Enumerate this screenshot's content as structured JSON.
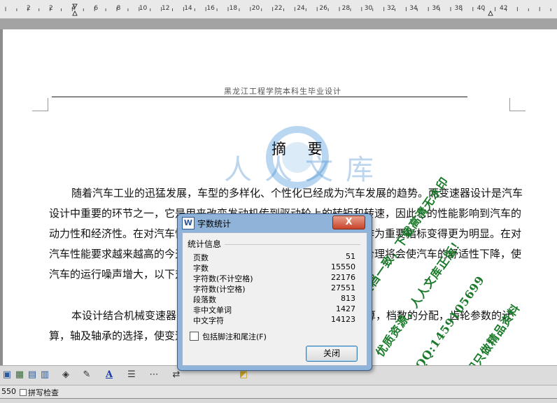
{
  "ruler": {
    "numbers": [
      "2",
      "2",
      "4",
      "6",
      "8",
      "10",
      "12",
      "14",
      "16",
      "18",
      "20",
      "22",
      "24",
      "26",
      "28",
      "30",
      "32",
      "34",
      "36",
      "38",
      "40",
      "42"
    ]
  },
  "document": {
    "header_text": "黑龙江工程学院本科生毕业设计",
    "title": "摘 要",
    "paragraph1": "随着汽车工业的迅猛发展，车型的多样化、个性化已经成为汽车发展的趋势。而变速器设计是汽车设计中重要的环节之一，它是用来改变发动机传到驱动轮上的转矩和转速，因此它的性能影响到汽车的动力性和经济性。在对汽车性能要求越来越高的今天，车辆的舒适性作为重要指标变得更为明显。在对汽车性能要求越来越高的今天，车辆的舒适性而变速器的设计如果不合理将会使汽车的舒适性下降，使汽车的运行噪声增大，以下对乘用车变速器进行系统深入的研究。",
    "paragraph2": "本设计结合机械变速器的设计方法，对变速器进行了系统化的计算，档数的分配，齿轮参数的计算，轴及轴承的选择，使变速器的传动效率有了很大的提高。"
  },
  "watermark": {
    "line1": "人人文库",
    "stamp1": "预览与源文档一致，下载高清无水印",
    "stamp2": "优质资源，人人文库正版！",
    "stamp3": "QQ:1459105699",
    "stamp4": "我们只做精品资料"
  },
  "dialog": {
    "title": "字数统计",
    "close_glyph": "X",
    "section_label": "统计信息",
    "rows": [
      {
        "label": "页数",
        "value": "51"
      },
      {
        "label": "字数",
        "value": "15550"
      },
      {
        "label": "字符数(不计空格)",
        "value": "22176"
      },
      {
        "label": "字符数(计空格)",
        "value": "27551"
      },
      {
        "label": "段落数",
        "value": "813"
      },
      {
        "label": "非中文单词",
        "value": "1427"
      },
      {
        "label": "中文字符",
        "value": "14123"
      }
    ],
    "checkbox_label": "包括脚注和尾注(F)",
    "close_button": "关闭"
  },
  "statusbar": {
    "page_count": "550",
    "spellcheck": "拼写检查"
  }
}
